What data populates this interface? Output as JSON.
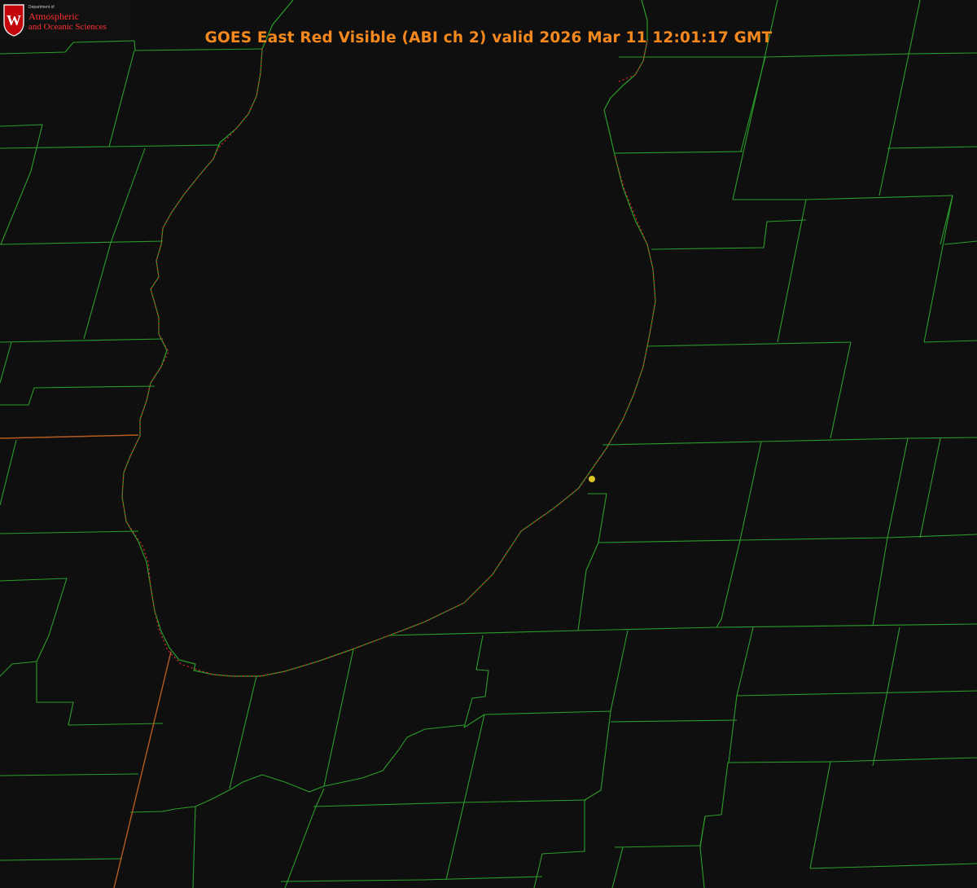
{
  "header": {
    "title": "GOES East Red Visible (ABI ch 2) valid 2026 Mar 11 12:01:17 GMT"
  },
  "logo": {
    "department_text": "Department of",
    "line1": "Atmospheric",
    "line2": "and Oceanic Sciences",
    "crest_letter": "W"
  },
  "colors": {
    "background": "#0f0f0f",
    "title": "#f5891e",
    "boundary_lines": "#2a9d2a",
    "state_line": "#b65a20",
    "shoreline_dotted": "#e02a2a",
    "marker": "#d8c623",
    "logo_text": "#ff3030",
    "crest_red": "#c5050c"
  },
  "map": {
    "layers": [
      "county-boundaries",
      "state-boundaries",
      "lake-shoreline",
      "station-marker"
    ],
    "marker": {
      "icon": "station-dot-icon"
    }
  }
}
